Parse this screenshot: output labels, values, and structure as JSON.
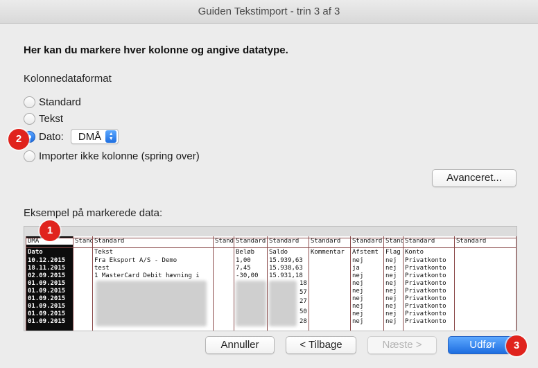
{
  "window": {
    "title": "Guiden Tekstimport - trin 3 af 3"
  },
  "heading": "Her kan du markere hver kolonne og angive datatype.",
  "format_section": {
    "label": "Kolonnedataformat",
    "options": [
      "Standard",
      "Tekst",
      "Dato:",
      "Importer ikke kolonne (spring over)"
    ],
    "selected": "Dato:",
    "date_format": "DMÅ"
  },
  "advanced_button": "Avanceret...",
  "preview": {
    "label": "Eksempel på markerede data:",
    "headers": [
      "DMÅ",
      "Stand",
      "Standard",
      "Stand",
      "Standard",
      "Standard",
      "Standard",
      "Standard",
      "Stand",
      "Standard",
      "Standard"
    ],
    "first_row": [
      "Dato",
      "",
      "Tekst",
      "",
      "Beløb",
      "Saldo",
      "Kommentar",
      "Afstemt",
      "Flag",
      "Konto",
      ""
    ],
    "col_dates": [
      "10.12.2015",
      "18.11.2015",
      "02.09.2015",
      "01.09.2015",
      "01.09.2015",
      "01.09.2015",
      "01.09.2015",
      "01.09.2015",
      "01.09.2015"
    ],
    "col_text": [
      "Fra Eksport A/S - Demo",
      "test",
      "1 MasterCard Debit hævning i"
    ],
    "col_amount": [
      "1,00",
      "7,45",
      "-30,00"
    ],
    "col_balance": [
      "15.939,63",
      "15.938,63",
      "15.931,18",
      "18",
      "57",
      "27",
      "50",
      "28"
    ],
    "col_afstemt": [
      "nej",
      "ja",
      "nej",
      "nej",
      "nej",
      "nej",
      "nej",
      "nej",
      "nej"
    ],
    "col_flag": [
      "nej",
      "nej",
      "nej",
      "nej",
      "nej",
      "nej",
      "nej",
      "nej",
      "nej"
    ],
    "col_konto": [
      "Privatkonto",
      "Privatkonto",
      "Privatkonto",
      "Privatkonto",
      "Privatkonto",
      "Privatkonto",
      "Privatkonto",
      "Privatkonto",
      "Privatkonto"
    ]
  },
  "buttons": {
    "cancel": "Annuller",
    "back": "< Tilbage",
    "next": "Næste >",
    "finish": "Udfør"
  },
  "badges": [
    "2",
    "1",
    "3"
  ],
  "colors": {
    "accent": "#1f6fe0",
    "badge": "#e0231d",
    "column_border": "#8b4a4a"
  }
}
